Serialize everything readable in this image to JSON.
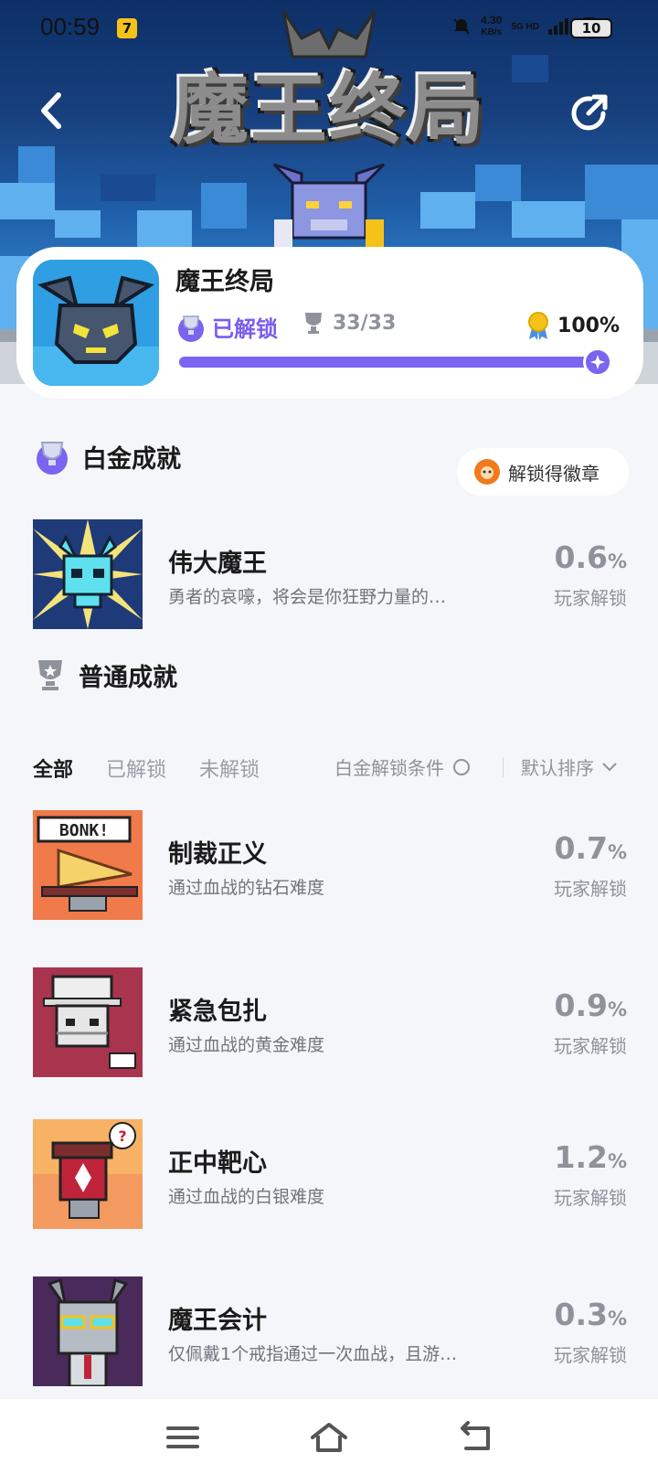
{
  "status_bar": {
    "time": "00:59",
    "app_badge": "7",
    "net_speed": "4.30",
    "net_unit": "KB/s",
    "signal_label": "5G HD",
    "battery": "10"
  },
  "header": {
    "logo_text": "魔王终局"
  },
  "game": {
    "name": "魔王终局",
    "status": "已解锁",
    "trophies": "33/33",
    "completion": "100%",
    "progress": 1.0
  },
  "platinum": {
    "title": "白金成就",
    "badge_button": "解锁得徽章",
    "achievement": {
      "name": "伟大魔王",
      "desc": "勇者的哀嚎，将会是你狂野力量的…",
      "pct": "0.6",
      "pct_unit": "%",
      "sub": "玩家解锁"
    }
  },
  "normal": {
    "title": "普通成就",
    "tabs": [
      "全部",
      "已解锁",
      "未解锁"
    ],
    "condition_label": "白金解锁条件",
    "sort_label": "默认排序",
    "achievements": [
      {
        "name": "制裁正义",
        "desc": "通过血战的钻石难度",
        "pct": "0.7",
        "pct_unit": "%",
        "sub": "玩家解锁"
      },
      {
        "name": "紧急包扎",
        "desc": "通过血战的黄金难度",
        "pct": "0.9",
        "pct_unit": "%",
        "sub": "玩家解锁"
      },
      {
        "name": "正中靶心",
        "desc": "通过血战的白银难度",
        "pct": "1.2",
        "pct_unit": "%",
        "sub": "玩家解锁"
      },
      {
        "name": "魔王会计",
        "desc": "仅佩戴1个戒指通过一次血战，且游…",
        "pct": "0.3",
        "pct_unit": "%",
        "sub": "玩家解锁"
      }
    ]
  },
  "icons": {
    "back": "chevron-left-icon",
    "share": "share-icon",
    "nav_menu": "menu-icon",
    "nav_home": "home-icon",
    "nav_back": "back-icon"
  },
  "colors": {
    "accent": "#7b64ef",
    "muted": "#8e939b",
    "badge_orange": "#f07a1c"
  }
}
